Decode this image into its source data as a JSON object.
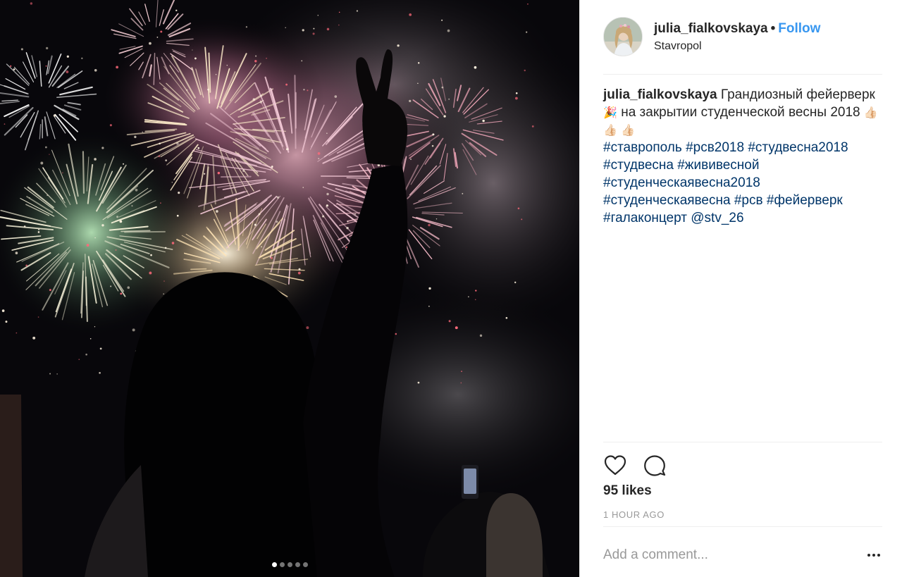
{
  "post": {
    "username": "julia_fialkovskaya",
    "separator": "•",
    "follow_label": "Follow",
    "location": "Stavropol"
  },
  "caption": {
    "username": "julia_fialkovskaya",
    "text_part1": "Грандиозный фейерверк",
    "emoji_party": "🎉",
    "text_part2": "на закрытии студенческой весны 2018",
    "emoji_thumbs": "👍🏻 👍🏻 👍🏻",
    "hashtags": [
      "#ставрополь",
      "#рсв2018",
      "#студвесна2018",
      "#студвесна",
      "#жививесной",
      "#студенческаявесна2018",
      "#студенческаявесна",
      "#рсв",
      "#фейерверк",
      "#галаконцерт",
      "@stv_26"
    ]
  },
  "actions": {
    "like_icon": "heart-icon",
    "comment_icon": "comment-icon",
    "likes": "95 likes",
    "timestamp": "1 HOUR AGO"
  },
  "comment": {
    "placeholder": "Add a comment...",
    "more_icon": "more-options-icon"
  },
  "carousel": {
    "total": 5,
    "active": 1
  },
  "colors": {
    "link_blue": "#3897f0",
    "hashtag_blue": "#003569",
    "muted": "#999999",
    "divider": "#efefef"
  }
}
